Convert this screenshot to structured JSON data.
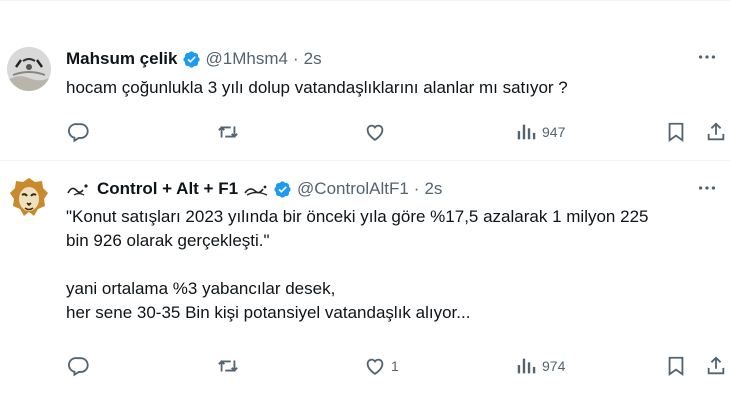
{
  "tweets": [
    {
      "name": "Mahsum çelik",
      "handle": "@1Mhsm4",
      "separator": "·",
      "time": "2s",
      "lines": [
        "hocam çoğunlukla 3 yılı dolup vatandaşlıklarını alanlar mı satıyor ?"
      ],
      "likes": "",
      "views": "947"
    },
    {
      "name": "Control + Alt + F1",
      "handle": "@ControlAltF1",
      "separator": "·",
      "time": "2s",
      "lines": [
        "\"Konut satışları 2023 yılında bir önceki yıla göre %17,5 azalarak 1 milyon 225",
        "bin 926 olarak gerçekleşti.\"",
        "yani ortalama %3 yabancılar desek,",
        "her sene 30-35 Bin kişi potansiyel vatandaşlık alıyor..."
      ],
      "likes": "1",
      "views": "974"
    }
  ],
  "icons": {
    "more": "more-icon",
    "reply": "reply-icon",
    "retweet": "retweet-icon",
    "like": "like-icon",
    "views": "views-icon",
    "bookmark": "bookmark-icon",
    "share": "share-icon",
    "verified": "verified-badge-icon"
  },
  "colors": {
    "text": "#0f1419",
    "secondary": "#536471",
    "verified": "#1d9bf0",
    "divider": "#eff3f4"
  }
}
